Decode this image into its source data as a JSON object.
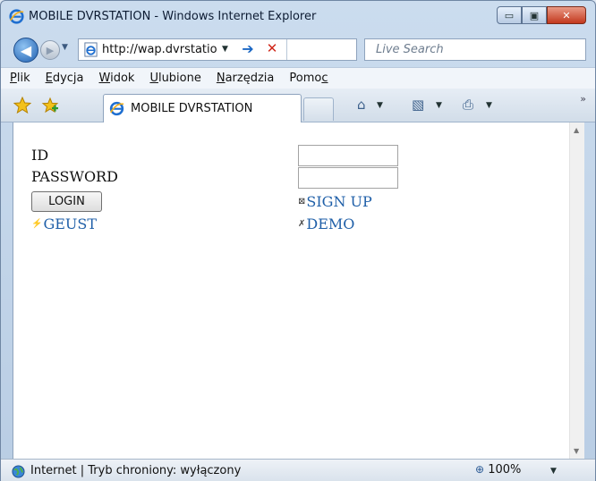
{
  "window": {
    "title": "MOBILE DVRSTATION - Windows Internet Explorer",
    "minimize_glyph": "▭",
    "maximize_glyph": "▣",
    "close_glyph": "✕"
  },
  "address_bar": {
    "back_glyph": "◀",
    "forward_glyph": "▶",
    "url": "http://wap.dvrstatio",
    "dropdown_glyph": "▼",
    "go_glyph": "➔",
    "stop_glyph": "✕",
    "search_placeholder": "Live Search"
  },
  "menu": {
    "items": [
      {
        "prefix": "",
        "u": "P",
        "rest": "lik"
      },
      {
        "prefix": "",
        "u": "E",
        "rest": "dycja"
      },
      {
        "prefix": "",
        "u": "W",
        "rest": "idok"
      },
      {
        "prefix": "",
        "u": "U",
        "rest": "lubione"
      },
      {
        "prefix": "",
        "u": "N",
        "rest": "arzędzia"
      },
      {
        "prefix": "Pomo",
        "u": "c",
        "rest": ""
      }
    ]
  },
  "tabs": {
    "active_label": "MOBILE DVRSTATION",
    "home_glyph": "⌂",
    "feeds_glyph": "▧",
    "print_glyph": "⎙",
    "dropdown_glyph": "▼",
    "overflow_glyph": "»"
  },
  "page": {
    "id_label": "ID",
    "password_label": "PASSWORD",
    "id_value": "",
    "password_value": "",
    "login_button": "LOGIN",
    "guest_link": "GEUST",
    "guest_icon": "⚡",
    "signup_link": "SIGN UP",
    "signup_icon": "⊠",
    "demo_link": "DEMO",
    "demo_icon": "✗"
  },
  "scrollbar": {
    "up_glyph": "▲",
    "down_glyph": "▼"
  },
  "status": {
    "text": "Internet | Tryb chroniony: wyłączony",
    "zoom_glyph": "⊕",
    "zoom": "100%",
    "zoom_dropdown_glyph": "▼"
  },
  "colors": {
    "link": "#1f5fa8",
    "close_button": "#c3381d",
    "frame": "#b9cde4"
  }
}
